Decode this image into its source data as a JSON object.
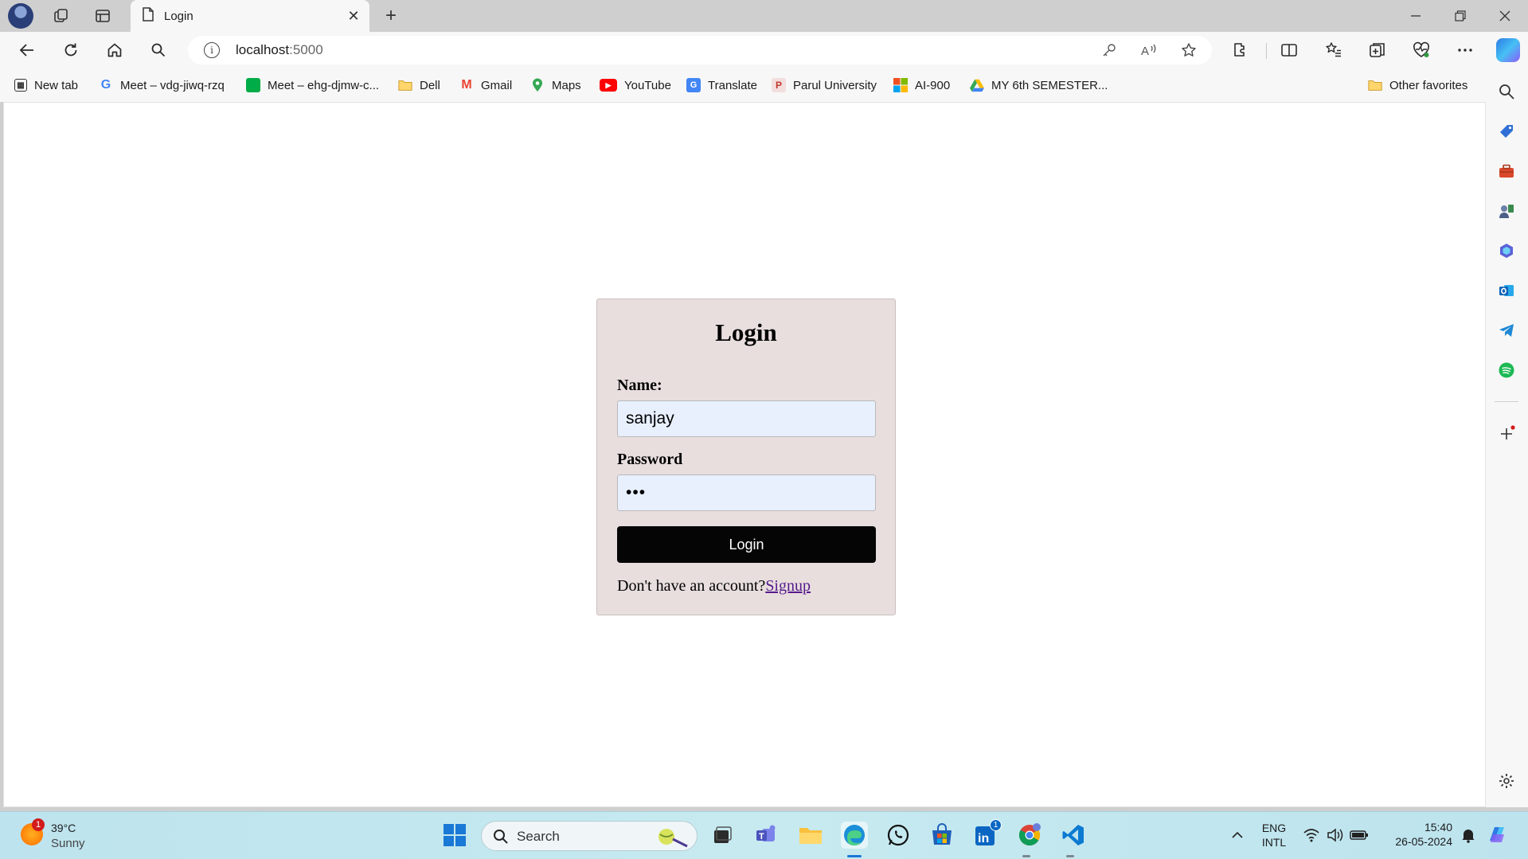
{
  "browser": {
    "tab_title": "Login",
    "url_host": "localhost",
    "url_port": ":5000"
  },
  "favorites": [
    {
      "label": "New tab",
      "icon": "new-tab-icon",
      "color": "#333333"
    },
    {
      "label": "Meet – vdg-jiwq-rzq",
      "icon": "google-icon",
      "color": "#4285f4"
    },
    {
      "label": "Meet – ehg-djmw-c...",
      "icon": "meet-icon",
      "color": "#00ac47"
    },
    {
      "label": "Dell",
      "icon": "folder-icon",
      "color": "#e8b64a"
    },
    {
      "label": "Gmail",
      "icon": "gmail-icon",
      "color": "#ea4335"
    },
    {
      "label": "Maps",
      "icon": "maps-icon",
      "color": "#34a853"
    },
    {
      "label": "YouTube",
      "icon": "youtube-icon",
      "color": "#ff0000"
    },
    {
      "label": "Translate",
      "icon": "translate-icon",
      "color": "#4285f4"
    },
    {
      "label": "Parul University",
      "icon": "university-icon",
      "color": "#c0392b"
    },
    {
      "label": "AI-900",
      "icon": "microsoft-icon",
      "color": "#f25022"
    },
    {
      "label": "MY 6th SEMESTER...",
      "icon": "google-drive-icon",
      "color": "#fbbc04"
    }
  ],
  "other_favorites": "Other favorites",
  "login": {
    "heading": "Login",
    "name_label": "Name:",
    "name_value": "sanjay",
    "password_label": "Password",
    "password_value": "•••",
    "button": "Login",
    "signup_prompt": "Don't have an account?",
    "signup_link": "Signup"
  },
  "taskbar": {
    "weather_temp": "39°C",
    "weather_desc": "Sunny",
    "weather_badge": "1",
    "search_label": "Search",
    "lang_line1": "ENG",
    "lang_line2": "INTL",
    "time": "15:40",
    "date": "26-05-2024",
    "linkedin_badge": "1"
  }
}
